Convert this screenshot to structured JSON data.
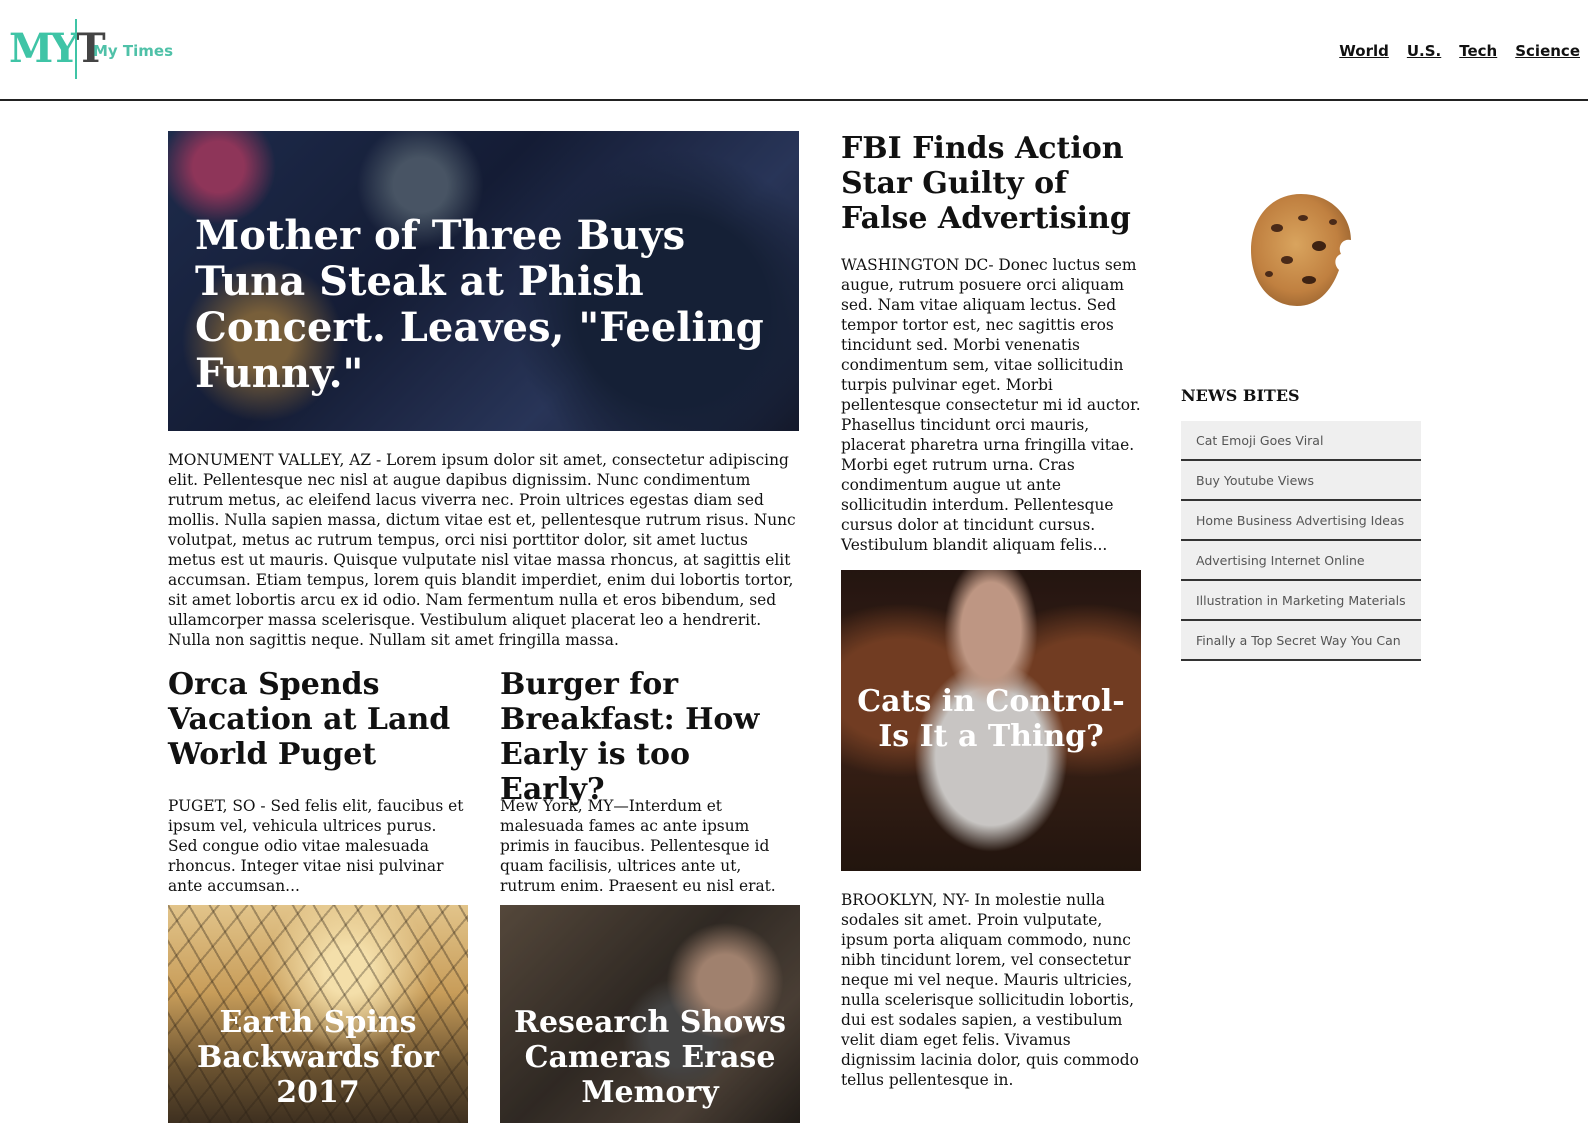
{
  "header": {
    "logo_m": "MY",
    "logo_t": "T",
    "brand_name": "My Times",
    "nav": [
      "World",
      "U.S.",
      "Tech",
      "Science"
    ]
  },
  "hero": {
    "title": "Mother of Three Buys Tuna Steak at Phish Concert. Leaves, \"Feeling Funny.\"",
    "body": "MONUMENT VALLEY, AZ - Lorem ipsum dolor sit amet, consectetur adipiscing elit. Pellentesque nec nisl at augue dapibus dignissim. Nunc condimentum rutrum metus, ac eleifend lacus viverra nec. Proin ultrices egestas diam sed mollis. Nulla sapien massa, dictum vitae est et, pellentesque rutrum risus. Nunc volutpat, metus ac rutrum tempus, orci nisi porttitor dolor, sit amet luctus metus est ut mauris. Quisque vulputate nisl vitae massa rhoncus, at sagittis elit accumsan. Etiam tempus, lorem quis blandit imperdiet, enim dui lobortis tortor, sit amet lobortis arcu ex id odio. Nam fermentum nulla et eros bibendum, sed ullamcorper massa scelerisque. Vestibulum aliquet placerat leo a hendrerit. Nulla non sagittis neque. Nullam sit amet fringilla massa."
  },
  "orca": {
    "title": "Orca Spends Vacation at Land World Puget",
    "body": "PUGET, SO - Sed felis elit, faucibus et ipsum vel, vehicula ultrices purus. Sed congue odio vitae malesuada rhoncus. Integer vitae nisi pulvinar ante accumsan..."
  },
  "burger": {
    "title": "Burger for Breakfast: How Early is too Early?",
    "body": "Mew York, MY—Interdum et malesuada fames ac ante ipsum primis in faucibus. Pellentesque id quam facilisis, ultrices ante ut, rutrum enim. Praesent eu nisl erat."
  },
  "earth_card": {
    "title": "Earth Spins Backwards for 2017"
  },
  "camera_card": {
    "title": "Research Shows Cameras Erase Memory"
  },
  "fbi": {
    "title": "FBI Finds Action Star Guilty of False Advertising",
    "body": "WASHINGTON DC- Donec luctus sem augue, rutrum posuere orci aliquam sed. Nam vitae aliquam lectus. Sed tempor tortor est, nec sagittis eros tincidunt sed. Morbi venenatis condimentum sem, vitae sollicitudin turpis pulvinar eget. Morbi pellentesque consectetur mi id auctor. Phasellus tincidunt orci mauris, placerat pharetra urna fringilla vitae. Morbi eget rutrum urna. Cras condimentum augue ut ante sollicitudin interdum. Pellentesque cursus dolor at tincidunt cursus. Vestibulum blandit aliquam felis..."
  },
  "cats_card": {
    "title": "Cats in Control-Is It a Thing?"
  },
  "brooklyn": {
    "body": "BROOKLYN, NY- In molestie nulla sodales sit amet. Proin vulputate, ipsum porta aliquam commodo, nunc nibh tincidunt lorem, vel consectetur neque mi vel neque. Mauris ultricies, nulla scelerisque sollicitudin lobortis, dui est sodales sapien, a vestibulum velit diam eget felis. Vivamus dignissim lacinia dolor, quis commodo tellus pellentesque in."
  },
  "sidebar": {
    "heading": "NEWS BITES",
    "items": [
      "Cat Emoji Goes Viral",
      "Buy Youtube Views",
      "Home Business Advertising Ideas",
      "Advertising Internet Online",
      "Illustration in Marketing Materials",
      "Finally a Top Secret Way You Can"
    ]
  },
  "colors": {
    "brand": "#3fc4a6",
    "brand_text": "#4fc1a8",
    "rule": "#222222",
    "bite_bg": "#efefef"
  }
}
